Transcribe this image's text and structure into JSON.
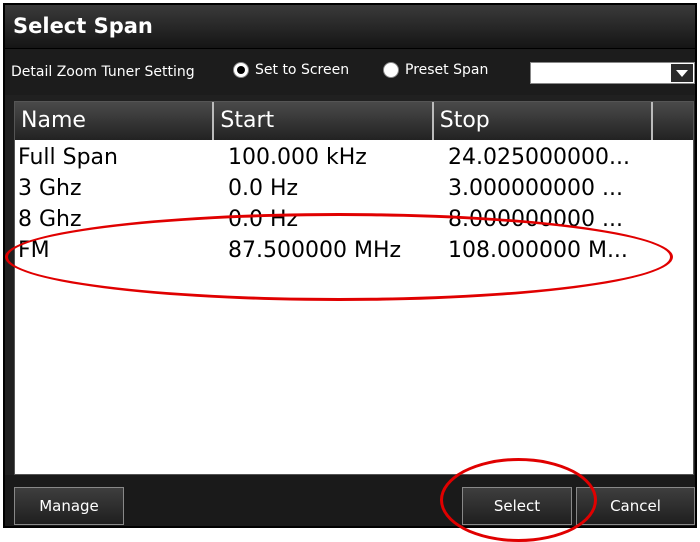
{
  "window": {
    "title": "Select Span"
  },
  "setting": {
    "label": "Detail Zoom Tuner Setting",
    "options": [
      {
        "label": "Set to Screen",
        "checked": true
      },
      {
        "label": "Preset Span",
        "checked": false
      }
    ],
    "combo_value": ""
  },
  "table": {
    "columns": [
      "Name",
      "Start",
      "Stop"
    ],
    "rows": [
      {
        "name": "Full Span",
        "start": "100.000 kHz",
        "stop": "24.025000000..."
      },
      {
        "name": "3 Ghz",
        "start": "0.0 Hz",
        "stop": "3.000000000 ..."
      },
      {
        "name": "8 Ghz",
        "start": "0.0 Hz",
        "stop": "8.000000000 ..."
      },
      {
        "name": "FM",
        "start": "87.500000 MHz",
        "stop": "108.000000 M..."
      }
    ]
  },
  "footer": {
    "manage_label": "Manage",
    "select_label": "Select",
    "cancel_label": "Cancel"
  },
  "colors": {
    "annotation": "#e00000",
    "background": "#202020"
  }
}
